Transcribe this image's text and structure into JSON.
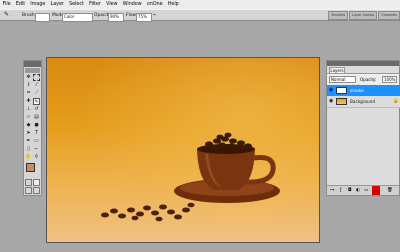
{
  "menu": [
    "File",
    "Edit",
    "Image",
    "Layer",
    "Select",
    "Filter",
    "View",
    "Window",
    "onOne",
    "Help"
  ],
  "options": {
    "brush_label": "Brush:",
    "brush_value": "",
    "mode_label": "Mode:",
    "mode_value": "Color",
    "opacity_label": "Opacity:",
    "opacity_value": "90%",
    "flow_label": "Flow:",
    "flow_value": "75%"
  },
  "palette_wells": [
    "Brushes",
    "Layer Comps",
    "Channels"
  ],
  "layers_panel": {
    "tab": "Layers",
    "blend_mode": "Normal",
    "opacity_label": "Opacity:",
    "opacity_value": "100%",
    "lock_label": "Lock:",
    "fill_label": "Fill:",
    "fill_value": "100%",
    "layers": [
      {
        "name": "smoke",
        "selected": true,
        "visible": true
      },
      {
        "name": "Background",
        "selected": false,
        "visible": true
      }
    ]
  },
  "colors": {
    "foreground": "#c98a62",
    "background": "#ffffff",
    "selection": "#1e90ff",
    "accent": "#d40000"
  }
}
